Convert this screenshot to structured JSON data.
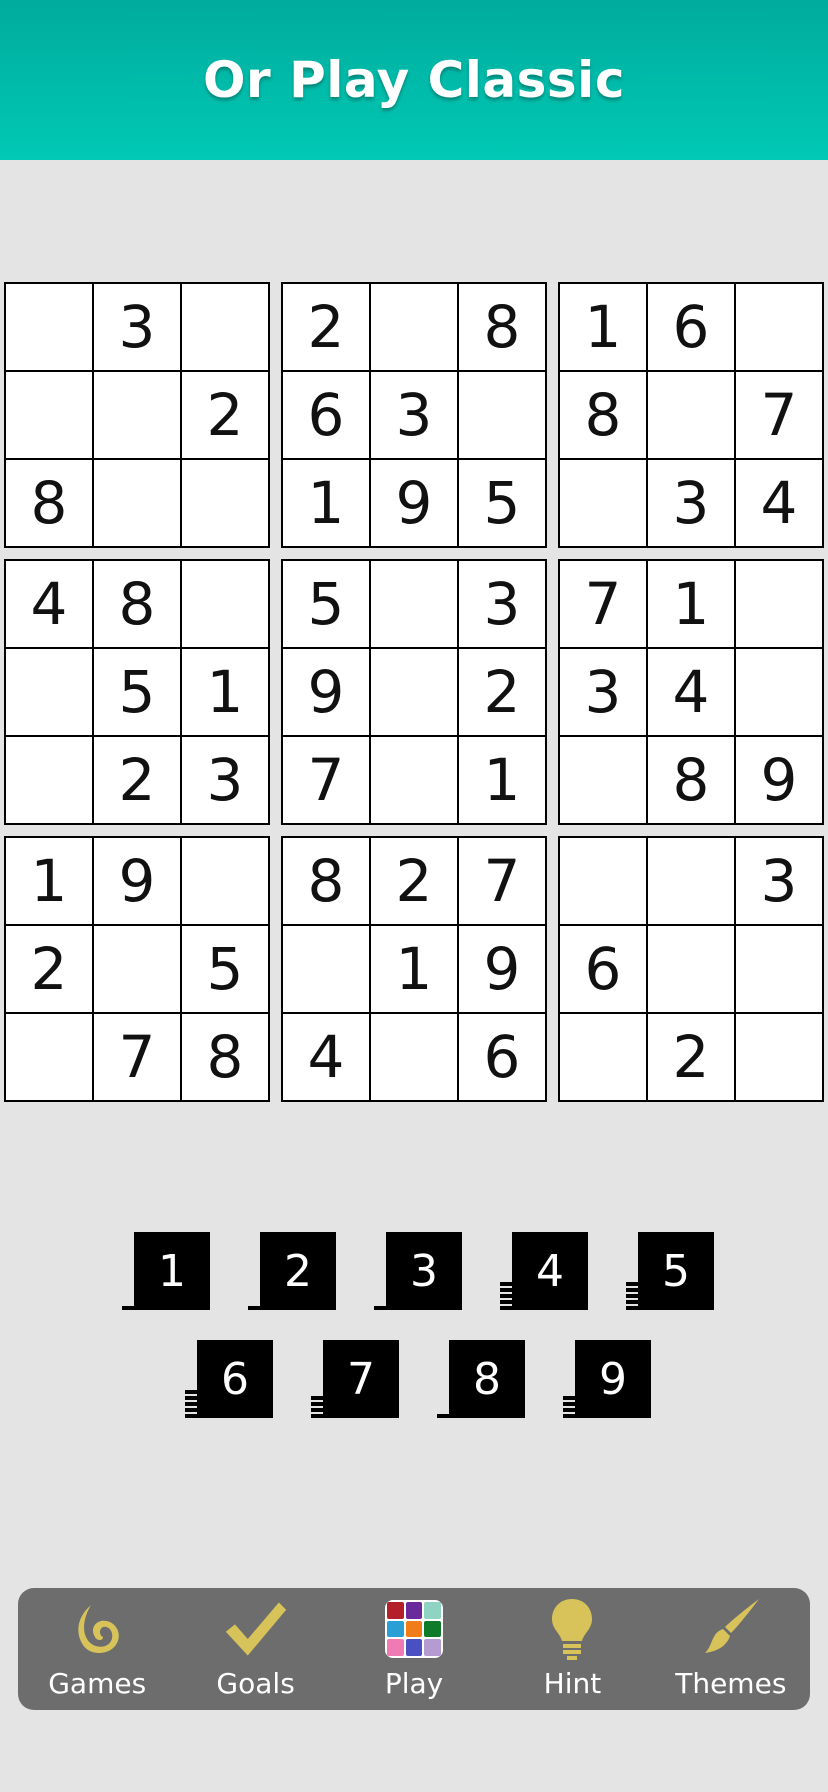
{
  "header": {
    "title": "Or Play Classic"
  },
  "board": {
    "grid": [
      [
        "",
        "3",
        "",
        "2",
        "",
        "8",
        "1",
        "6",
        ""
      ],
      [
        "",
        "",
        "2",
        "6",
        "3",
        "",
        "8",
        "",
        "7"
      ],
      [
        "8",
        "",
        "",
        "1",
        "9",
        "5",
        "",
        "3",
        "4"
      ],
      [
        "4",
        "8",
        "",
        "5",
        "",
        "3",
        "7",
        "1",
        ""
      ],
      [
        "",
        "5",
        "1",
        "9",
        "",
        "2",
        "3",
        "4",
        ""
      ],
      [
        "",
        "2",
        "3",
        "7",
        "",
        "1",
        "",
        "8",
        "9"
      ],
      [
        "1",
        "9",
        "",
        "8",
        "2",
        "7",
        "",
        "",
        "3"
      ],
      [
        "2",
        "",
        "5",
        "",
        "1",
        "9",
        "6",
        "",
        ""
      ],
      [
        "",
        "7",
        "8",
        "4",
        "",
        "6",
        "",
        "2",
        ""
      ]
    ]
  },
  "keypad": {
    "keys": [
      {
        "label": "1",
        "remaining_shown": 1
      },
      {
        "label": "2",
        "remaining_shown": 1
      },
      {
        "label": "3",
        "remaining_shown": 1
      },
      {
        "label": "4",
        "remaining_shown": 5
      },
      {
        "label": "5",
        "remaining_shown": 5
      },
      {
        "label": "6",
        "remaining_shown": 5
      },
      {
        "label": "7",
        "remaining_shown": 4
      },
      {
        "label": "8",
        "remaining_shown": 1
      },
      {
        "label": "9",
        "remaining_shown": 4
      }
    ]
  },
  "nav": {
    "items": [
      {
        "label": "Games",
        "icon": "games-icon"
      },
      {
        "label": "Goals",
        "icon": "checkmark-icon"
      },
      {
        "label": "Play",
        "icon": "color-grid-icon"
      },
      {
        "label": "Hint",
        "icon": "lightbulb-icon"
      },
      {
        "label": "Themes",
        "icon": "paintbrush-icon"
      }
    ],
    "icon_color": "#d8c35a",
    "play_colors": [
      "#b3202a",
      "#6a2a9c",
      "#8fd3c2",
      "#2a9fd6",
      "#f07c1a",
      "#0f7a2a",
      "#f07ab4",
      "#4a4fc2",
      "#b49bd1"
    ]
  },
  "colors": {
    "header_top": "#00ab9d",
    "header_bottom": "#00c9b4",
    "background": "#e4e4e4",
    "navbar": "#6d6d6d"
  }
}
